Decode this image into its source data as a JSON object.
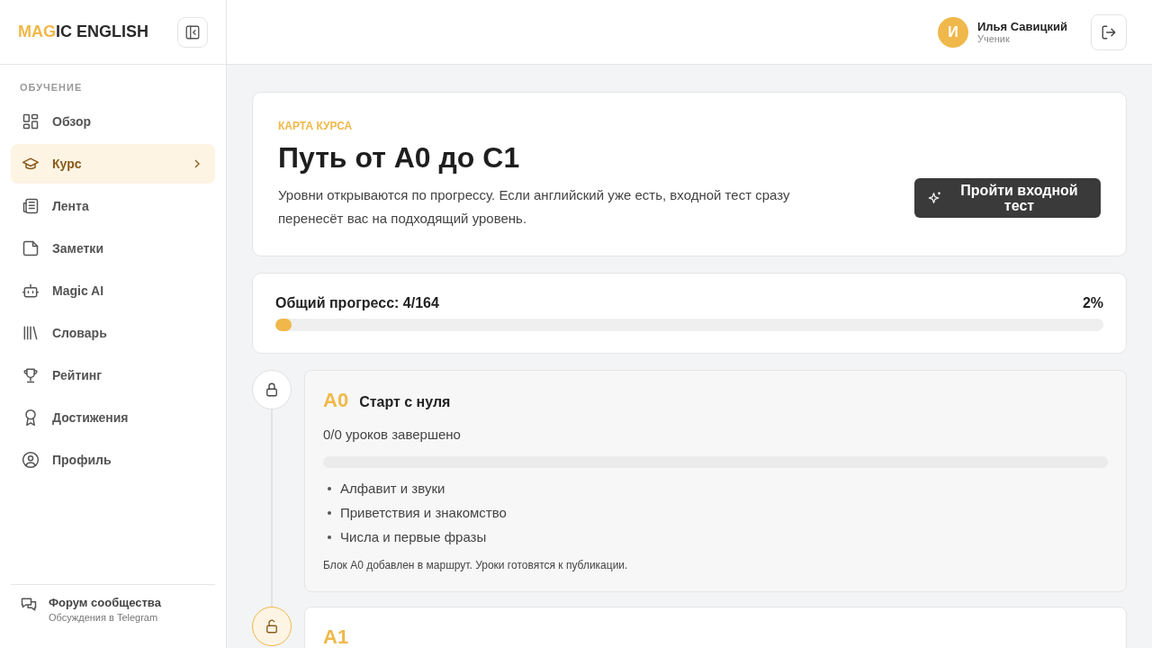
{
  "logo": {
    "accent": "MAG",
    "rest": "IC ENGLISH"
  },
  "sidebar": {
    "section": "ОБУЧЕНИЕ",
    "items": [
      {
        "label": "Обзор",
        "selected": false
      },
      {
        "label": "Курс",
        "selected": true
      },
      {
        "label": "Лента",
        "selected": false
      },
      {
        "label": "Заметки",
        "selected": false
      },
      {
        "label": "Magic AI",
        "selected": false
      },
      {
        "label": "Словарь",
        "selected": false
      },
      {
        "label": "Рейтинг",
        "selected": false
      },
      {
        "label": "Достижения",
        "selected": false
      },
      {
        "label": "Профиль",
        "selected": false
      }
    ],
    "footer": {
      "title": "Форум сообщества",
      "subtitle": "Обсуждения в Telegram"
    }
  },
  "user": {
    "initial": "И",
    "name": "Илья Савицкий",
    "role": "Ученик"
  },
  "hero": {
    "eyebrow": "КАРТА КУРСА",
    "title": "Путь от A0 до C1",
    "text": "Уровни открываются по прогрессу. Если английский уже есть, входной тест сразу перенесёт вас на подходящий уровень.",
    "button": "Пройти входной тест"
  },
  "progress": {
    "label": "Общий прогресс: 4/164",
    "percent": "2%",
    "level": 0.02
  },
  "levels": [
    {
      "code": "A0",
      "title": "Старт с нуля",
      "locked": true,
      "lessons": "0/0 уроков завершено",
      "topics": [
        "Алфавит и звуки",
        "Приветствия и знакомство",
        "Числа и первые фразы"
      ],
      "note": "Блок A0 добавлен в маршрут. Уроки готовятся к публикации."
    },
    {
      "code": "A1",
      "locked": false
    }
  ]
}
